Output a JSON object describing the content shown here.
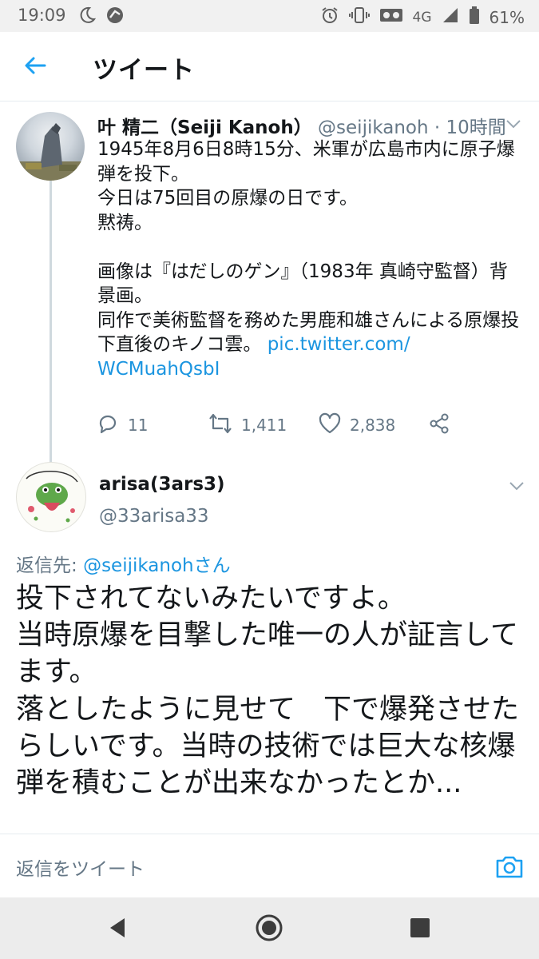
{
  "status_bar": {
    "time": "19:09",
    "network": "4G",
    "battery": "61%",
    "icons": [
      "moon-icon",
      "app-icon",
      "alarm-icon",
      "vibrate-icon",
      "voicemail-icon",
      "signal-icon",
      "battery-icon"
    ]
  },
  "header": {
    "title": "ツイート",
    "back_icon": "arrow-left-icon",
    "accent_color": "#1da1f2"
  },
  "tweet1": {
    "name": "叶 精二（Seiji Kanoh）",
    "handle": "@seijikanoh",
    "separator": " · ",
    "time": "10時間",
    "body_text": "1945年8月6日8時15分、米軍が広島市内に原子爆弾を投下。\n今日は75回目の原爆の日です。\n黙祷。\n\n画像は『はだしのゲン』（1983年 真崎守監督）背景画。\n同作で美術監督を務めた男鹿和雄さんによる原爆投下直後のキノコ雲。 ",
    "link_text": "pic.twitter.com/​WCMuahQsbI",
    "link_color": "#1b95e0",
    "actions": {
      "reply_count": "11",
      "retweet_count": "1,411",
      "like_count": "2,838"
    }
  },
  "tweet2": {
    "name": "arisa(3ars3)",
    "handle": "@33arisa33",
    "replying_prefix": "返信先: ",
    "replying_handle": "@seijikanoh",
    "replying_suffix": "さん",
    "body_text": "投下されてないみたいですよ。\n当時原爆を目撃した唯一の人が証言してます。\n落としたように見せて　下で爆発させたらしいです。当時の技術では巨大な核爆弾を積むことが出来なかったとか..."
  },
  "reply_bar": {
    "placeholder": "返信をツイート",
    "camera_icon": "camera-icon"
  },
  "nav_bar": {
    "icons": [
      "back-triangle-icon",
      "home-circle-icon",
      "recents-square-icon"
    ]
  }
}
